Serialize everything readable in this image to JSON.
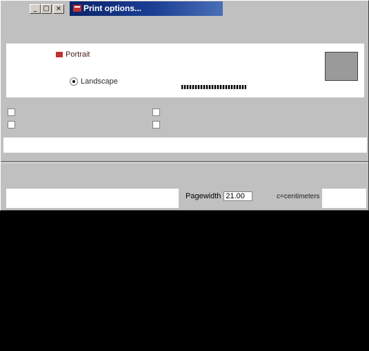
{
  "window": {
    "title": "Print options...",
    "min_glyph": "_",
    "max_glyph": "□",
    "close_glyph": "×"
  },
  "hint": "",
  "orientation": {
    "group_label": "",
    "portrait_label": "Portrait",
    "landscape_label": "Landscape",
    "selected": "landscape"
  },
  "options": {
    "opt1": "",
    "opt2": "",
    "opt3": "",
    "opt4": ""
  },
  "status_text": "",
  "page_width": {
    "label": "Pagewidth",
    "value": "21.00",
    "unit_note_line1": "",
    "unit_note_line2": "c=centimeters"
  },
  "colors": {
    "title_bar": "#0a246a",
    "dialog_face": "#c0c0c0",
    "accent_red": "#c03030"
  },
  "icons": {
    "app": "app-icon",
    "portrait": "portrait-icon",
    "landscape": "landscape-icon"
  }
}
